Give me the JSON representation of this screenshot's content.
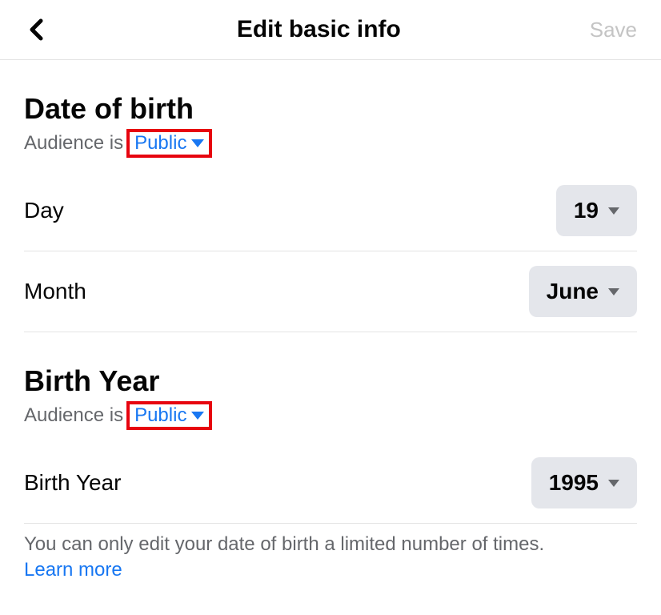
{
  "header": {
    "title": "Edit basic info",
    "save_label": "Save"
  },
  "dob_section": {
    "title": "Date of birth",
    "audience_label": "Audience is",
    "audience_value": "Public",
    "day_label": "Day",
    "day_value": "19",
    "month_label": "Month",
    "month_value": "June"
  },
  "year_section": {
    "title": "Birth Year",
    "audience_label": "Audience is",
    "audience_value": "Public",
    "year_label": "Birth Year",
    "year_value": "1995"
  },
  "note": {
    "text": "You can only edit your date of birth a limited number of times.",
    "learn_more": "Learn more"
  }
}
